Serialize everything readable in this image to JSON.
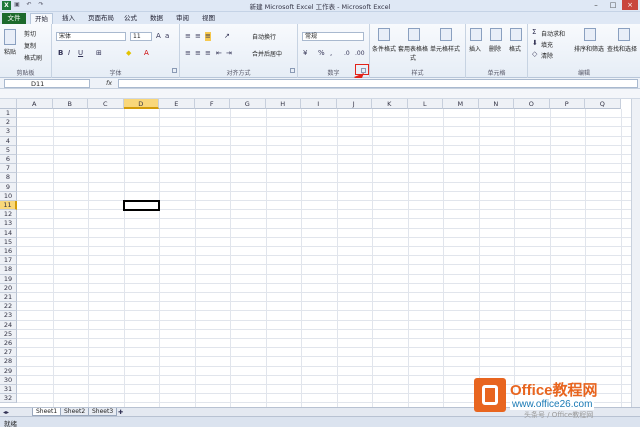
{
  "window": {
    "title": "新建 Microsoft Excel 工作表 - Microsoft Excel"
  },
  "tabs": [
    "文件",
    "开始",
    "插入",
    "页面布局",
    "公式",
    "数据",
    "审阅",
    "视图"
  ],
  "active_tab": "开始",
  "ribbon": {
    "clipboard": {
      "label": "剪贴板",
      "paste": "粘贴",
      "cut": "剪切",
      "copy": "复制",
      "format_painter": "格式刷"
    },
    "font": {
      "label": "字体",
      "family": "宋体",
      "size": "11"
    },
    "alignment": {
      "label": "对齐方式",
      "wrap": "自动换行",
      "merge": "合并后居中"
    },
    "number": {
      "label": "数字",
      "format": "常规"
    },
    "styles": {
      "label": "样式",
      "conditional": "条件格式",
      "table": "套用表格格式",
      "cell": "单元格样式"
    },
    "cells": {
      "label": "单元格",
      "insert": "插入",
      "delete": "删除",
      "format": "格式"
    },
    "editing": {
      "label": "编辑",
      "autosum": "自动求和",
      "fill": "填充",
      "clear": "清除",
      "sort": "排序和筛选",
      "find": "查找和选择"
    }
  },
  "formula_bar": {
    "name_box": "D11",
    "fx": "fx",
    "content": ""
  },
  "columns": [
    "A",
    "B",
    "C",
    "D",
    "E",
    "F",
    "G",
    "H",
    "I",
    "J",
    "K",
    "L",
    "M",
    "N",
    "O",
    "P",
    "Q"
  ],
  "rows": [
    "1",
    "2",
    "3",
    "4",
    "5",
    "6",
    "7",
    "8",
    "9",
    "10",
    "11",
    "12",
    "13",
    "14",
    "15",
    "16",
    "17",
    "18",
    "19",
    "20",
    "21",
    "22",
    "23",
    "24",
    "25",
    "26",
    "27",
    "28",
    "29",
    "30",
    "31",
    "32"
  ],
  "selected_column": "D",
  "selected_row": "11",
  "sheets": [
    "Sheet1",
    "Sheet2",
    "Sheet3"
  ],
  "status": "就绪",
  "watermark": {
    "brand": "Office教程网",
    "url": "www.office26.com",
    "caption": "头条号 / Office教程网"
  },
  "colors": {
    "file_tab": "#1d6a2c",
    "highlight": "#e2231a",
    "brand": "#e8651f"
  }
}
